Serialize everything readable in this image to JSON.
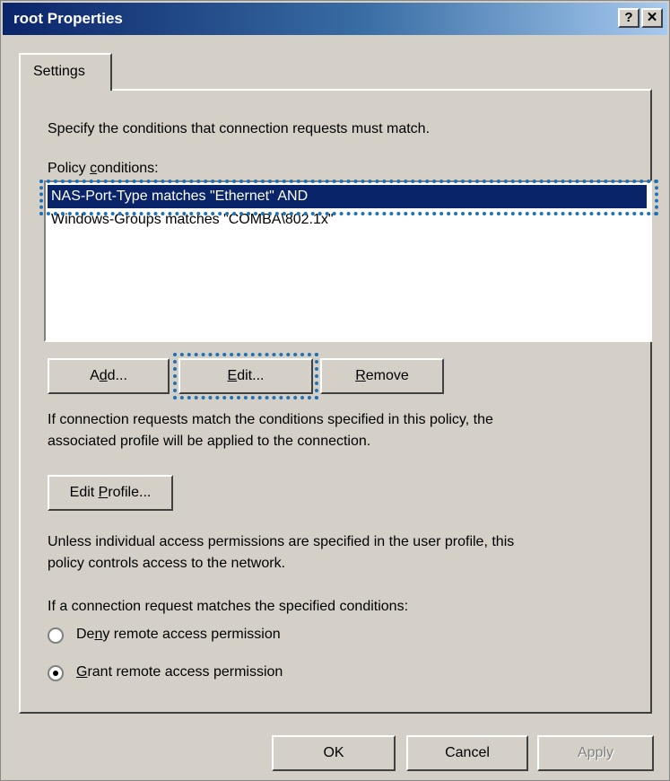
{
  "window": {
    "title": "root Properties",
    "help_label": "?",
    "close_label": "✕"
  },
  "tabs": [
    {
      "label": "Settings"
    }
  ],
  "settings": {
    "intro": "Specify the conditions that connection requests must match.",
    "conditions_label": {
      "pre": "Policy ",
      "accel": "c",
      "post": "onditions:"
    },
    "conditions": [
      "NAS-Port-Type matches \"Ethernet\" AND",
      "Windows-Groups matches \"COMBA\\802.1x\""
    ],
    "add_button": {
      "pre": "A",
      "accel": "d",
      "post": "d..."
    },
    "edit_button": {
      "pre": "",
      "accel": "E",
      "post": "dit..."
    },
    "remove_button": {
      "pre": "",
      "accel": "R",
      "post": "emove"
    },
    "match_info_line1": "If connection requests match the conditions specified in this policy, the",
    "match_info_line2": "associated profile will be applied to the connection.",
    "edit_profile_button": {
      "pre": "Edit ",
      "accel": "P",
      "post": "rofile..."
    },
    "permissions_info_line1": "Unless individual access permissions are specified in the user profile, this",
    "permissions_info_line2": "policy controls access to the network.",
    "radio_group_label": "If a connection request matches the specified conditions:",
    "deny_option": {
      "pre": "De",
      "accel": "n",
      "post": "y remote access permission",
      "checked": false
    },
    "grant_option": {
      "pre": "",
      "accel": "G",
      "post": "rant remote access permission",
      "checked": true
    }
  },
  "footer": {
    "ok_label": "OK",
    "cancel_label": "Cancel",
    "apply_label": "Apply"
  },
  "colors": {
    "selection": "#0a246a",
    "highlight_box": "#1e73b8",
    "dialog_face": "#d4d0c8"
  }
}
